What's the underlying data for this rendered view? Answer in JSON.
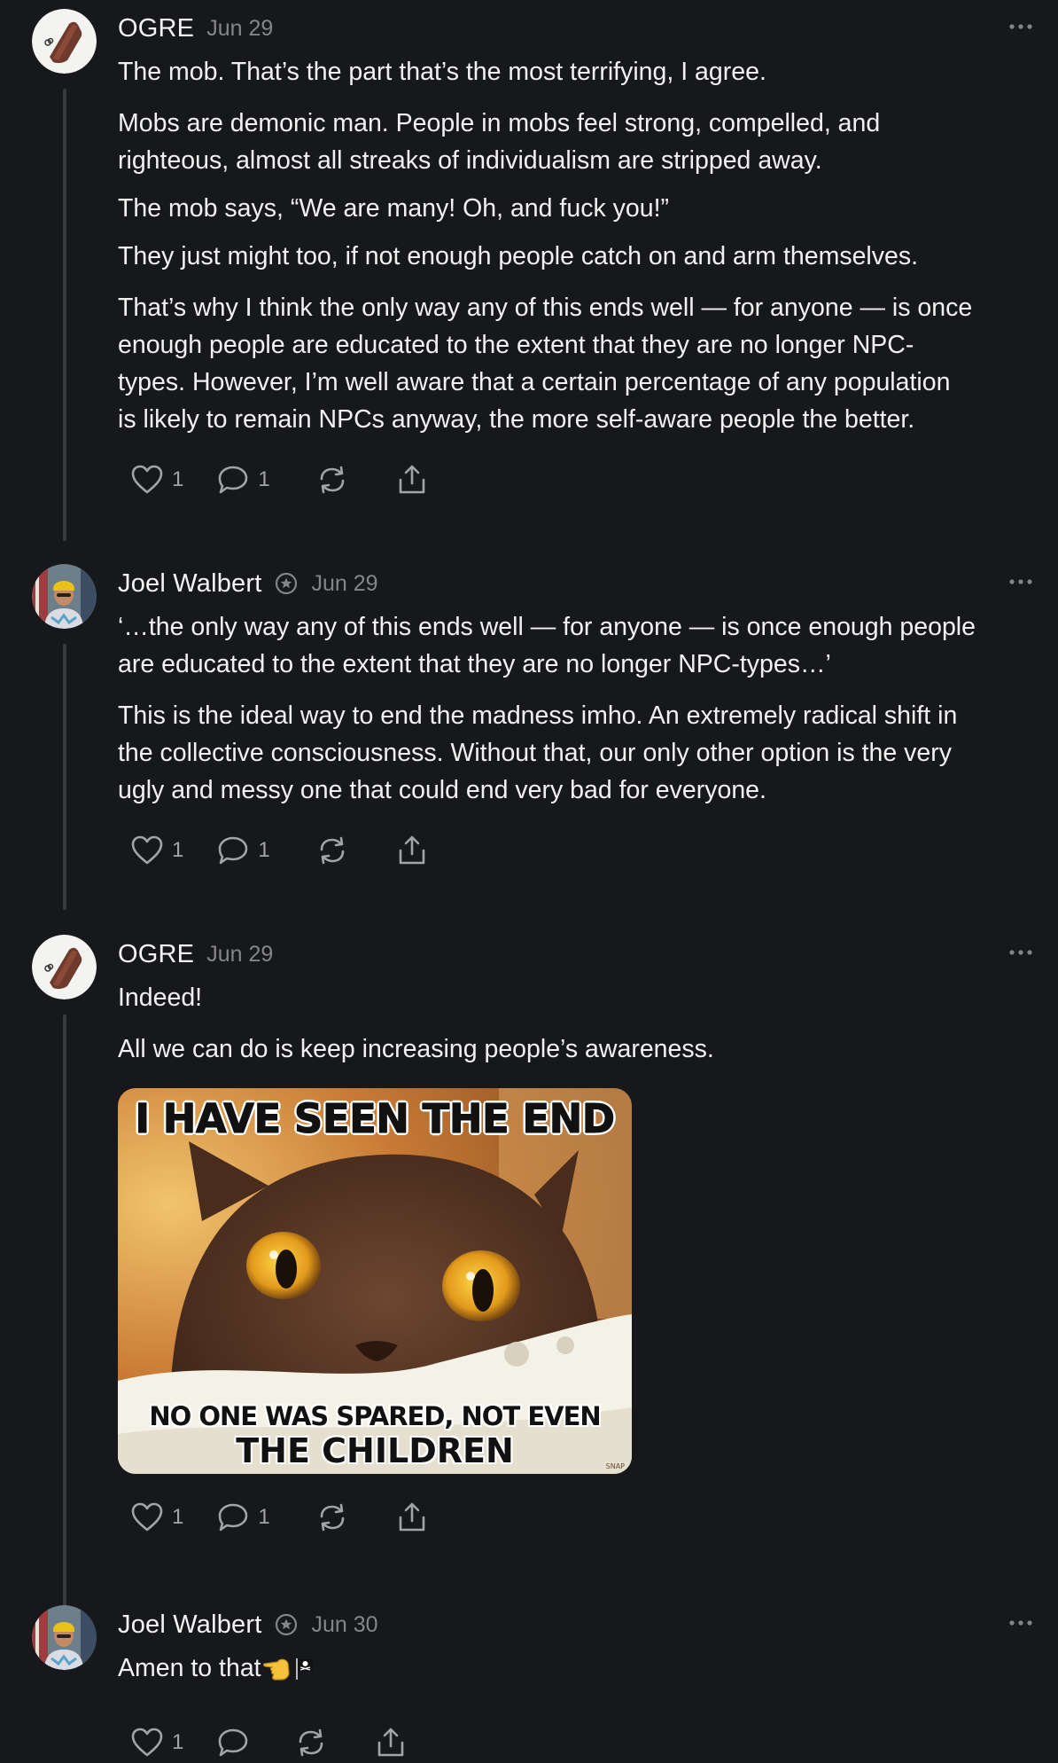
{
  "colors": {
    "background": "#17181b",
    "text": "#f1f1f2",
    "muted": "#84858b",
    "icon": "#a2a3a8",
    "thread_line": "#3a3b3f"
  },
  "posts": [
    {
      "author": "OGRE",
      "date": "Jun 29",
      "avatar": "ogre-avatar",
      "verified": false,
      "paragraphs": [
        [
          "The mob. That’s the part that’s the most terrifying, I agree."
        ],
        [
          "Mobs are demonic man. People in mobs feel strong, compelled, and",
          "righteous, almost all streaks of individualism are stripped away."
        ],
        [
          "The mob says, “We are many! Oh, and fuck you!”"
        ],
        [
          "They just might too, if not enough people catch on and arm themselves."
        ],
        [
          "That’s why I think the only way any of this ends well — for anyone — is once",
          "enough people are educated to the extent that they are no longer NPC-",
          "types. However, I’m well aware that a certain percentage of any population",
          "is likely to remain NPCs anyway, the more self-aware people the better."
        ]
      ],
      "likes": "1",
      "comments": "1"
    },
    {
      "author": "Joel Walbert",
      "date": "Jun 29",
      "avatar": "joel-avatar",
      "verified": true,
      "paragraphs": [
        [
          "‘…the only way any of this ends well — for anyone — is once enough people",
          "are educated to the extent that they are no longer NPC-types…’"
        ],
        [
          "This is the ideal way to end the madness imho. An extremely radical shift in",
          "the collective consciousness. Without that, our only other option is the very",
          "ugly and messy one that could end very bad for everyone."
        ]
      ],
      "likes": "1",
      "comments": "1"
    },
    {
      "author": "OGRE",
      "date": "Jun 29",
      "avatar": "ogre-avatar",
      "verified": false,
      "paragraphs": [
        [
          "Indeed!"
        ],
        [
          "All we can do is keep increasing people’s awareness."
        ]
      ],
      "meme": {
        "top_text": "I HAVE SEEN THE END",
        "bottom_line1": "NO ONE WAS SPARED, NOT EVEN",
        "bottom_line2": "THE CHILDREN",
        "watermark": "SNAP"
      },
      "likes": "1",
      "comments": "1"
    },
    {
      "author": "Joel Walbert",
      "date": "Jun 30",
      "avatar": "joel-avatar",
      "verified": true,
      "text": "Amen to that",
      "emoji": [
        "pointing-left-emoji",
        "pirate-flag-emoji"
      ],
      "likes": "1",
      "comments": ""
    }
  ]
}
